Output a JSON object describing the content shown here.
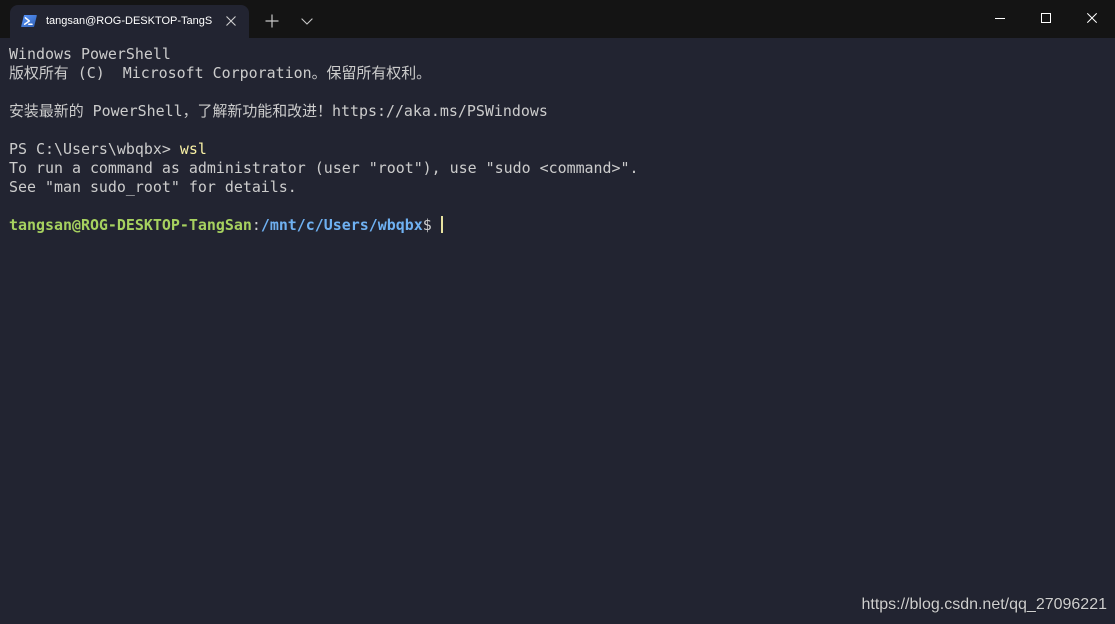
{
  "window": {
    "tabs": [
      {
        "title": "tangsan@ROG-DESKTOP-TangS",
        "icon": "powershell-icon",
        "close_icon": "close-icon"
      }
    ],
    "tab_row_icons": {
      "new_tab": "plus-icon",
      "dropdown": "chevron-down-icon"
    },
    "caption_buttons": [
      "minimize-icon",
      "maximize-icon",
      "close-icon"
    ]
  },
  "terminal": {
    "banner": [
      "Windows PowerShell",
      "版权所有 (C)  Microsoft Corporation。保留所有权利。"
    ],
    "install_hint": "安装最新的 PowerShell，了解新功能和改进！https://aka.ms/PSWindows",
    "ps_prompt": "PS C:\\Users\\wbqbx> ",
    "ps_command": "wsl",
    "wsl_notice": [
      "To run a command as administrator (user \"root\"), use \"sudo <command>\".",
      "See \"man sudo_root\" for details."
    ],
    "bash_prompt": {
      "user_host": "tangsan@ROG-DESKTOP-TangSan",
      "separator": ":",
      "cwd": "/mnt/c/Users/wbqbx",
      "symbol": "$ "
    }
  },
  "watermark": "https://blog.csdn.net/qq_27096221",
  "colors": {
    "titlebar": "#141414",
    "background": "#222431",
    "foreground": "#cccccc",
    "command": "#f9f1a5",
    "prompt_user": "#a6d15f",
    "prompt_path": "#6fb1f2",
    "cursor": "#e8e2a0",
    "watermark": "#cfcfcf"
  }
}
